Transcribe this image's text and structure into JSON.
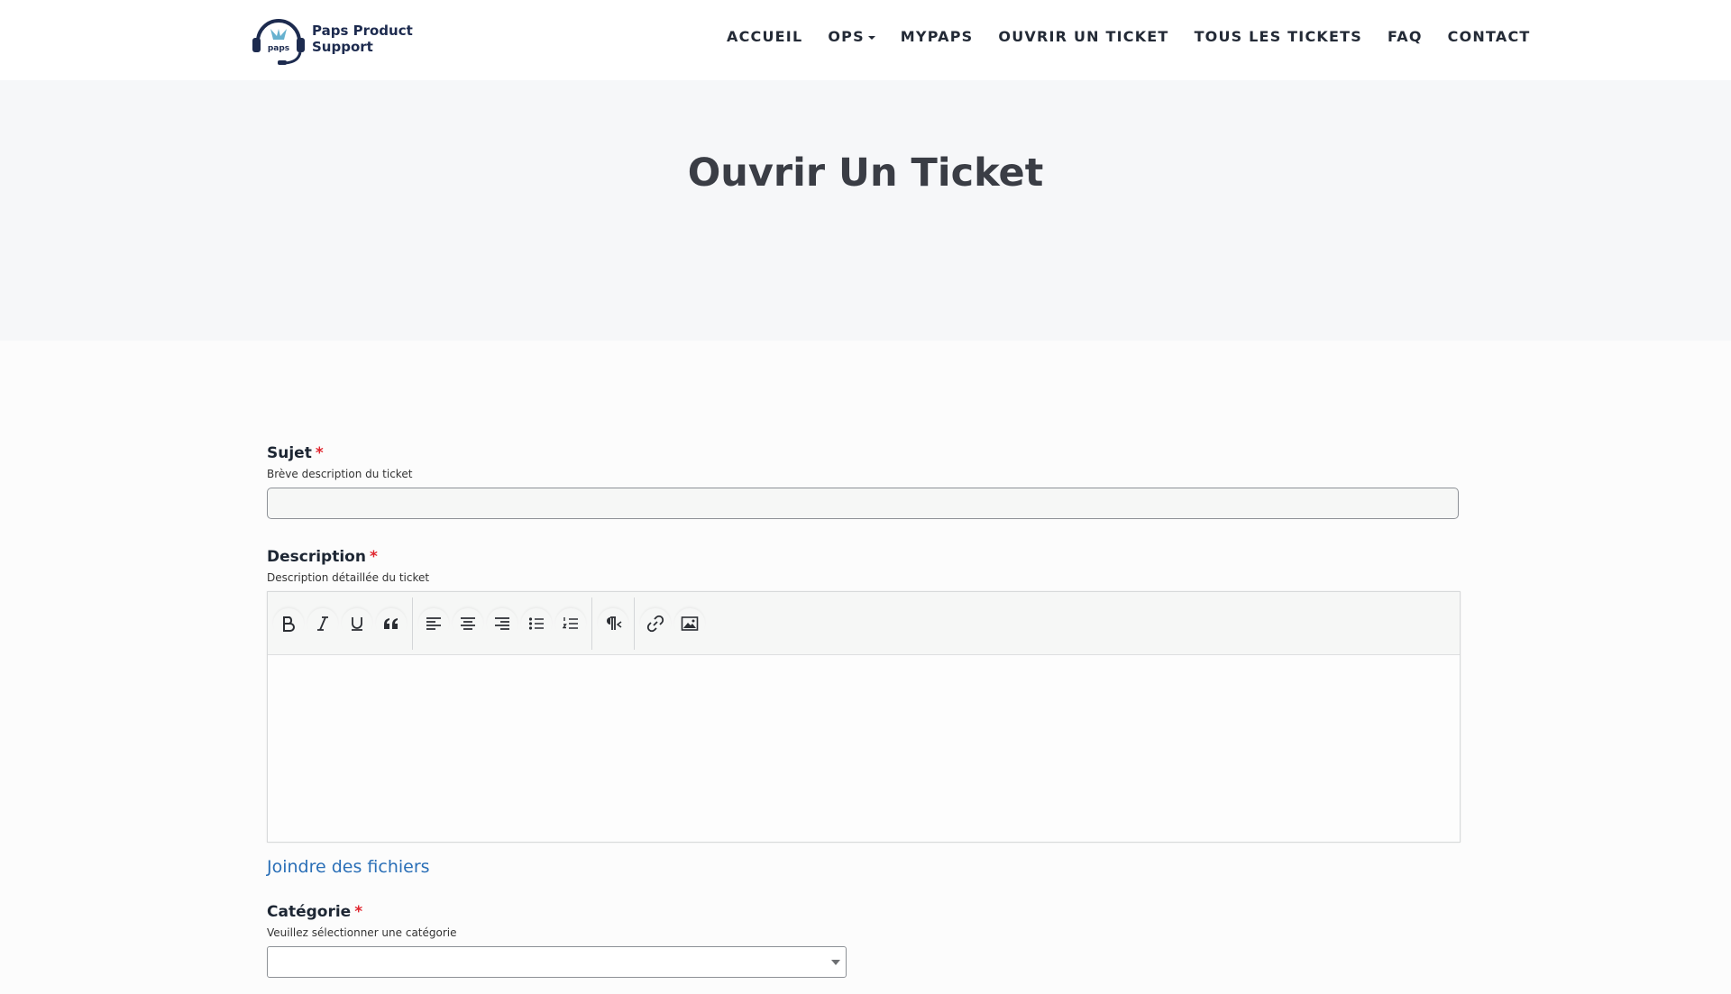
{
  "brand": {
    "name_line1": "Paps Product",
    "name_line2": "Support",
    "logo_text": "paps",
    "colors": {
      "navy": "#1d2b4f",
      "accent_link": "#2a6fb7",
      "required": "#e0262f"
    }
  },
  "nav": {
    "items": [
      {
        "label": "ACCUEIL"
      },
      {
        "label": "OPS",
        "has_dropdown": true
      },
      {
        "label": "MYPAPS"
      },
      {
        "label": "OUVRIR UN TICKET"
      },
      {
        "label": "TOUS LES TICKETS"
      },
      {
        "label": "FAQ"
      },
      {
        "label": "CONTACT"
      }
    ]
  },
  "hero": {
    "title": "Ouvrir Un Ticket"
  },
  "form": {
    "subject": {
      "label": "Sujet",
      "required_mark": "*",
      "hint": "Brève description du ticket",
      "value": ""
    },
    "description": {
      "label": "Description",
      "required_mark": "*",
      "hint": "Description détaillée du ticket",
      "toolbar": [
        "bold-icon",
        "italic-icon",
        "underline-icon",
        "blockquote-icon",
        "align-left-icon",
        "align-center-icon",
        "align-right-icon",
        "bullet-list-icon",
        "numbered-list-icon",
        "paragraph-direction-icon",
        "link-icon",
        "image-icon"
      ]
    },
    "attach_label": "Joindre des fichiers",
    "category": {
      "label": "Catégorie",
      "required_mark": "*",
      "hint": "Veuillez sélectionner une catégorie",
      "selected": ""
    }
  }
}
